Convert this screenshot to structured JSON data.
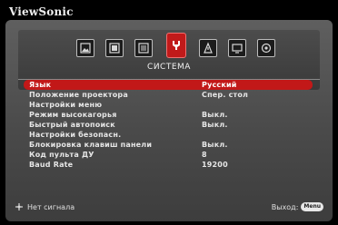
{
  "brand": "ViewSonic",
  "tabs": {
    "active_title": "СИСТЕМА",
    "icons": [
      "picture-icon",
      "image-settings-icon",
      "advanced-icon",
      "system-icon",
      "information-icon",
      "display-icon",
      "options-icon"
    ]
  },
  "menu": {
    "items": [
      {
        "label": "Язык",
        "value": "Русский"
      },
      {
        "label": "Положение проектора",
        "value": "Спер.   стол"
      },
      {
        "label": "Настройки меню",
        "value": ""
      },
      {
        "label": "Режим высокагорья",
        "value": "Выкл."
      },
      {
        "label": "Быстрый автопоиск",
        "value": "Выкл."
      },
      {
        "label": "Настройки безопасн.",
        "value": ""
      },
      {
        "label": "Блокировка клавиш панели",
        "value": "Выкл."
      },
      {
        "label": "Код пульта ДУ",
        "value": "8"
      },
      {
        "label": "Baud Rate",
        "value": "19200"
      }
    ]
  },
  "footer": {
    "status": "Нет сигнала",
    "exit_label": "Выход:",
    "menu_key": "Menu"
  },
  "colors": {
    "accent": "#c21818",
    "panel": "#4a4a4a"
  }
}
